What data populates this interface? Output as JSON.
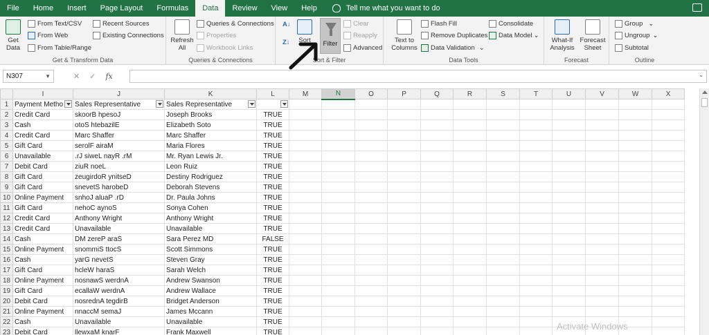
{
  "menu": {
    "tabs": [
      "File",
      "Home",
      "Insert",
      "Page Layout",
      "Formulas",
      "Data",
      "Review",
      "View",
      "Help"
    ],
    "active": "Data",
    "tell_me": "Tell me what you want to do"
  },
  "ribbon": {
    "get_transform": {
      "get_data": "Get Data",
      "from_text_csv": "From Text/CSV",
      "from_web": "From Web",
      "from_table_range": "From Table/Range",
      "recent_sources": "Recent Sources",
      "existing_connections": "Existing Connections",
      "label": "Get & Transform Data"
    },
    "queries": {
      "refresh_all": "Refresh All",
      "queries_connections": "Queries & Connections",
      "properties": "Properties",
      "workbook_links": "Workbook Links",
      "label": "Queries & Connections"
    },
    "sort_filter": {
      "sort": "Sort",
      "filter": "Filter",
      "clear": "Clear",
      "reapply": "Reapply",
      "advanced": "Advanced",
      "label": "Sort & Filter"
    },
    "data_tools": {
      "text_to_columns": "Text to Columns",
      "flash_fill": "Flash Fill",
      "remove_duplicates": "Remove Duplicates",
      "data_validation": "Data Validation",
      "consolidate": "Consolidate",
      "data_model": "Data Model",
      "label": "Data Tools"
    },
    "forecast": {
      "what_if": "What-If Analysis",
      "forecast_sheet": "Forecast Sheet",
      "label": "Forecast"
    },
    "outline": {
      "group": "Group",
      "ungroup": "Ungroup",
      "subtotal": "Subtotal",
      "label": "Outline"
    }
  },
  "formula_bar": {
    "name_box": "N307",
    "cancel": "✕",
    "enter": "✓",
    "fx": "fx",
    "formula": ""
  },
  "sheet": {
    "selected_column": "N",
    "columns": [
      "I",
      "J",
      "K",
      "L",
      "M",
      "N",
      "O",
      "P",
      "Q",
      "R",
      "S",
      "T",
      "U",
      "V",
      "W",
      "X"
    ],
    "header_row": [
      "Payment Metho",
      "Sales Representative",
      "Sales Representative",
      ""
    ],
    "rows": [
      [
        "Credit Card",
        "skoorB hpesoJ",
        "Joseph Brooks",
        "TRUE"
      ],
      [
        "Cash",
        "otoS htebazilE",
        "Elizabeth Soto",
        "TRUE"
      ],
      [
        "Credit Card",
        "Marc Shaffer",
        "Marc Shaffer",
        "TRUE"
      ],
      [
        "Gift Card",
        "serolF airaM",
        "Maria Flores",
        "TRUE"
      ],
      [
        "Unavailable",
        ".rJ siweL nayR .rM",
        "Mr. Ryan Lewis Jr.",
        "TRUE"
      ],
      [
        "Debit Card",
        "ziuR noeL",
        "Leon Ruiz",
        "TRUE"
      ],
      [
        "Gift Card",
        "zeugirdoR ynitseD",
        "Destiny Rodriguez",
        "TRUE"
      ],
      [
        "Gift Card",
        "snevetS harobeD",
        "Deborah Stevens",
        "TRUE"
      ],
      [
        "Online Payment",
        "snhoJ aluaP .rD",
        "Dr. Paula Johns",
        "TRUE"
      ],
      [
        "Gift Card",
        "nehoC aynoS",
        "Sonya Cohen",
        "TRUE"
      ],
      [
        "Credit Card",
        "Anthony Wright",
        "Anthony Wright",
        "TRUE"
      ],
      [
        "Credit Card",
        "Unavailable",
        "Unavailable",
        "TRUE"
      ],
      [
        "Cash",
        "DM zereP araS",
        "Sara Perez MD",
        "FALSE"
      ],
      [
        "Online Payment",
        "snommiS ttocS",
        "Scott Simmons",
        "TRUE"
      ],
      [
        "Cash",
        "yarG nevetS",
        "Steven Gray",
        "TRUE"
      ],
      [
        "Gift Card",
        "hcleW haraS",
        "Sarah Welch",
        "TRUE"
      ],
      [
        "Online Payment",
        "nosnawS werdnA",
        "Andrew Swanson",
        "TRUE"
      ],
      [
        "Gift Card",
        "ecallaW werdnA",
        "Andrew Wallace",
        "TRUE"
      ],
      [
        "Debit Card",
        "nosrednA tegdirB",
        "Bridget Anderson",
        "TRUE"
      ],
      [
        "Online Payment",
        "nnaccM semaJ",
        "James Mccann",
        "TRUE"
      ],
      [
        "Cash",
        "Unavailable",
        "Unavailable",
        "TRUE"
      ],
      [
        "Debit Card",
        "llewxaM knarF",
        "Frank Maxwell",
        "TRUE"
      ]
    ]
  },
  "watermark": "Activate Windows"
}
